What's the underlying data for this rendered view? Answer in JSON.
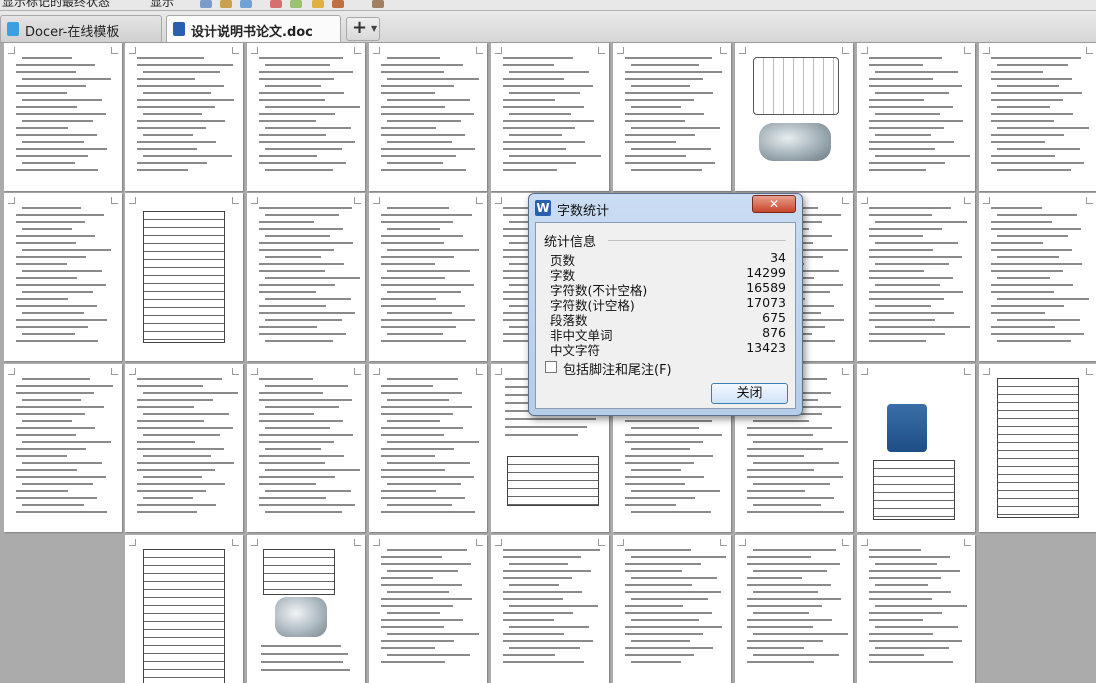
{
  "toolbar": {
    "left_text": "显示标记的最终状态",
    "show_label": "显示"
  },
  "tabs": [
    {
      "label": "Docer-在线模板",
      "close": "✕"
    },
    {
      "label": "设计说明书论文.doc",
      "close": "✕"
    }
  ],
  "new_tab": {
    "plus": "+",
    "dropdown": "▼"
  },
  "dialog": {
    "title": "字数统计",
    "icon_letter": "W",
    "close_glyph": "✕",
    "group_title": "统计信息",
    "stats": [
      {
        "label": "页数",
        "value": "34"
      },
      {
        "label": "字数",
        "value": "14299"
      },
      {
        "label": "字符数(不计空格)",
        "value": "16589"
      },
      {
        "label": "字符数(计空格)",
        "value": "17073"
      },
      {
        "label": "段落数",
        "value": "675"
      },
      {
        "label": "非中文单词",
        "value": "876"
      },
      {
        "label": "中文字符",
        "value": "13423"
      }
    ],
    "checkbox_label": "包括脚注和尾注(F)",
    "checkbox_checked": false,
    "close_button": "关闭"
  },
  "colors": {
    "accent": "#2a5fb0",
    "background": "#ababab"
  }
}
